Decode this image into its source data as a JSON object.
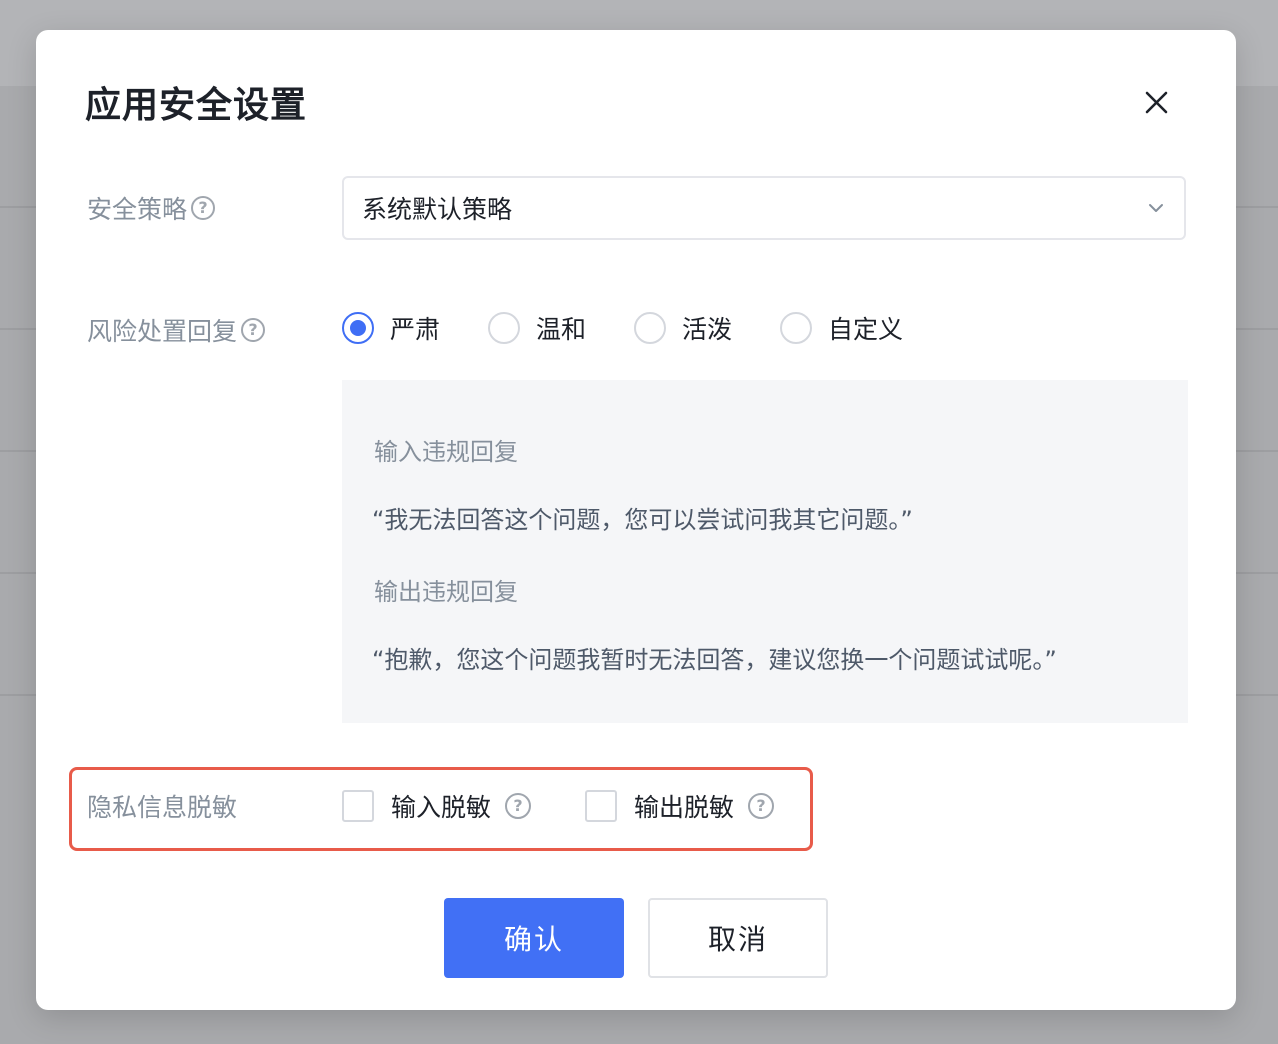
{
  "dialog": {
    "title": "应用安全设置"
  },
  "security_policy": {
    "label": "安全策略",
    "selected": "系统默认策略"
  },
  "risk_reply": {
    "label": "风险处置回复",
    "options": [
      "严肃",
      "温和",
      "活泼",
      "自定义"
    ],
    "selected_index": 0,
    "input_title": "输入违规回复",
    "input_text": "“我无法回答这个问题，您可以尝试问我其它问题。”",
    "output_title": "输出违规回复",
    "output_text": "“抱歉，您这个问题我暂时无法回答，建议您换一个问题试试呢。”"
  },
  "privacy": {
    "label": "隐私信息脱敏",
    "input_mask": "输入脱敏",
    "output_mask": "输出脱敏",
    "input_checked": false,
    "output_checked": false
  },
  "buttons": {
    "confirm": "确认",
    "cancel": "取消"
  },
  "colors": {
    "accent": "#4170f5",
    "highlight_frame": "#e85b4a"
  },
  "icons": {
    "help": "?"
  }
}
